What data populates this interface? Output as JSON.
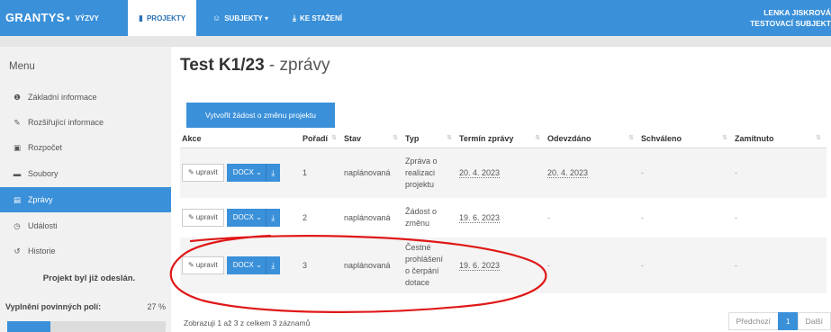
{
  "nav": {
    "brand": "GRANTYS",
    "items": [
      {
        "label": "VÝZVY",
        "icon": "megaphone-icon"
      },
      {
        "label": "PROJEKTY",
        "icon": "document-icon"
      },
      {
        "label": "SUBJEKTY ▾",
        "icon": "users-icon"
      },
      {
        "label": "KE STAŽENÍ",
        "icon": "download-icon"
      }
    ],
    "user_name": "LENKA JISKROVÁ",
    "user_subject": "TESTOVACÍ SUBJEKT"
  },
  "sidebar": {
    "title": "Menu",
    "items": [
      {
        "label": "Základní informace",
        "icon": "info-icon"
      },
      {
        "label": "Rozšiřující informace",
        "icon": "edit-icon"
      },
      {
        "label": "Rozpočet",
        "icon": "money-icon"
      },
      {
        "label": "Soubory",
        "icon": "folder-icon"
      },
      {
        "label": "Zprávy",
        "icon": "report-icon"
      },
      {
        "label": "Události",
        "icon": "clock-icon"
      },
      {
        "label": "Historie",
        "icon": "history-icon"
      }
    ],
    "active_index": 4,
    "sent_note": "Projekt byl již odeslán.",
    "progress_label": "Vyplnění povinných polí:",
    "progress_text": "27 %",
    "progress_value": 0.27
  },
  "main": {
    "title_bold": "Test K1/23",
    "title_rest": " - zprávy",
    "create_button": "Vytvořit žádost o změnu projektu",
    "columns": [
      "Akce",
      "Pořadí",
      "Stav",
      "Typ",
      "Termín zprávy",
      "Odevzdáno",
      "Schváleno",
      "Zamítnuto"
    ],
    "edit_label": "upravit",
    "docx_label": "DOCX",
    "rows": [
      {
        "poradi": "1",
        "stav": "naplánovaná",
        "typ": [
          "Zpráva o",
          "realizaci",
          "projektu"
        ],
        "termin": "20. 4. 2023",
        "odevzdano": "20. 4. 2023",
        "schvaleno": "-",
        "zamitnuto": "-"
      },
      {
        "poradi": "2",
        "stav": "naplánovaná",
        "typ": [
          "Žádost o",
          "změnu"
        ],
        "termin": "19. 6. 2023",
        "odevzdano": "-",
        "schvaleno": "-",
        "zamitnuto": "-"
      },
      {
        "poradi": "3",
        "stav": "naplánovaná",
        "typ": [
          "Čestné",
          "prohlášení",
          "o čerpání",
          "dotace"
        ],
        "termin": "19. 6. 2023",
        "odevzdano": "-",
        "schvaleno": "-",
        "zamitnuto": "-"
      }
    ],
    "footer_info": "Zobrazuji 1 až 3 z celkem 3 záznamů",
    "pager": {
      "prev": "Předchozí",
      "current": "1",
      "next": "Další"
    }
  },
  "colors": {
    "accent": "#3a90d9",
    "annotation": "#e01818"
  }
}
